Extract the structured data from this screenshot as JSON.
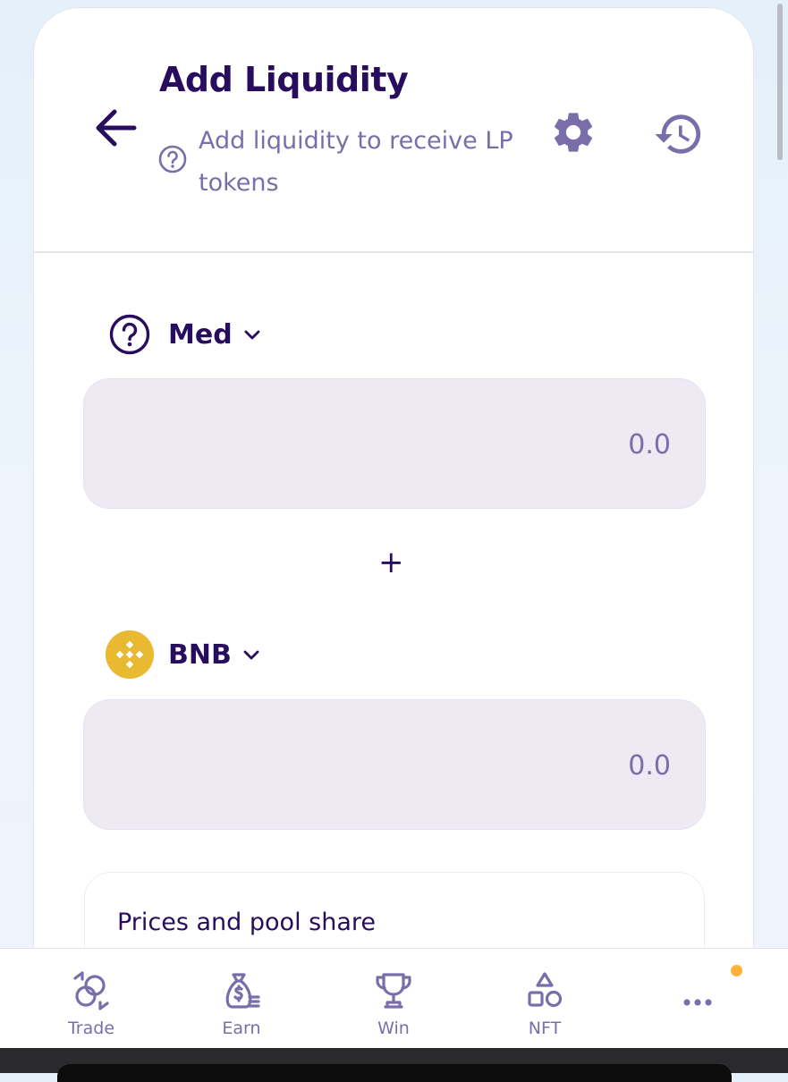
{
  "header": {
    "title": "Add Liquidity",
    "subtitle": "Add liquidity to receive LP tokens"
  },
  "token_a": {
    "symbol": "Med",
    "amount_placeholder": "0.0",
    "amount_value": ""
  },
  "separator": "+",
  "token_b": {
    "symbol": "BNB",
    "amount_placeholder": "0.0",
    "amount_value": ""
  },
  "prices_panel": {
    "title": "Prices and pool share"
  },
  "bottom_nav": {
    "items": [
      {
        "label": "Trade",
        "icon": "trade-icon"
      },
      {
        "label": "Earn",
        "icon": "earn-icon"
      },
      {
        "label": "Win",
        "icon": "trophy-icon"
      },
      {
        "label": "NFT",
        "icon": "nft-icon"
      },
      {
        "label": "",
        "icon": "more-icon"
      }
    ]
  },
  "colors": {
    "primary_text": "#280d5f",
    "secondary_text": "#7a6eaa",
    "icon_purple": "#7a6eaa",
    "input_bg": "#eeeaf4",
    "bnb_yellow": "#e8b931",
    "notification": "#ffb237"
  }
}
